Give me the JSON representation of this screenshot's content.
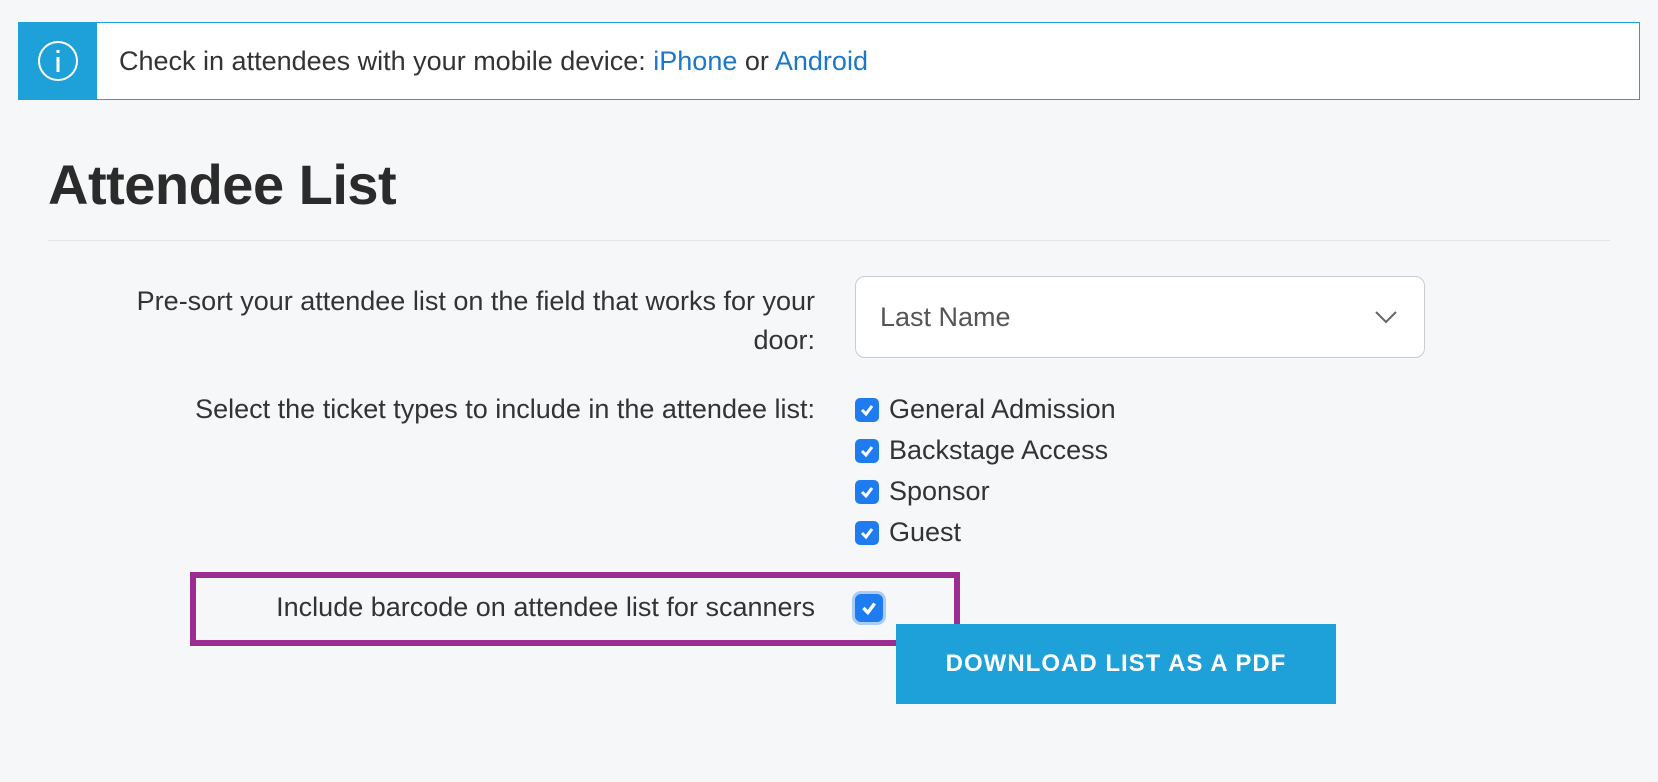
{
  "banner": {
    "prefix": "Check in attendees with your mobile device: ",
    "iphone": "iPhone",
    "or": " or ",
    "android": "Android"
  },
  "page_title": "Attendee List",
  "sort": {
    "label": "Pre-sort your attendee list on the field that works for your door:",
    "selected": "Last Name"
  },
  "ticket_types": {
    "label": "Select the ticket types to include in the attendee list:",
    "items": [
      "General Admission",
      "Backstage Access",
      "Sponsor",
      "Guest"
    ]
  },
  "barcode": {
    "label": "Include barcode on attendee list for scanners"
  },
  "download_button": "DOWNLOAD LIST AS A PDF"
}
